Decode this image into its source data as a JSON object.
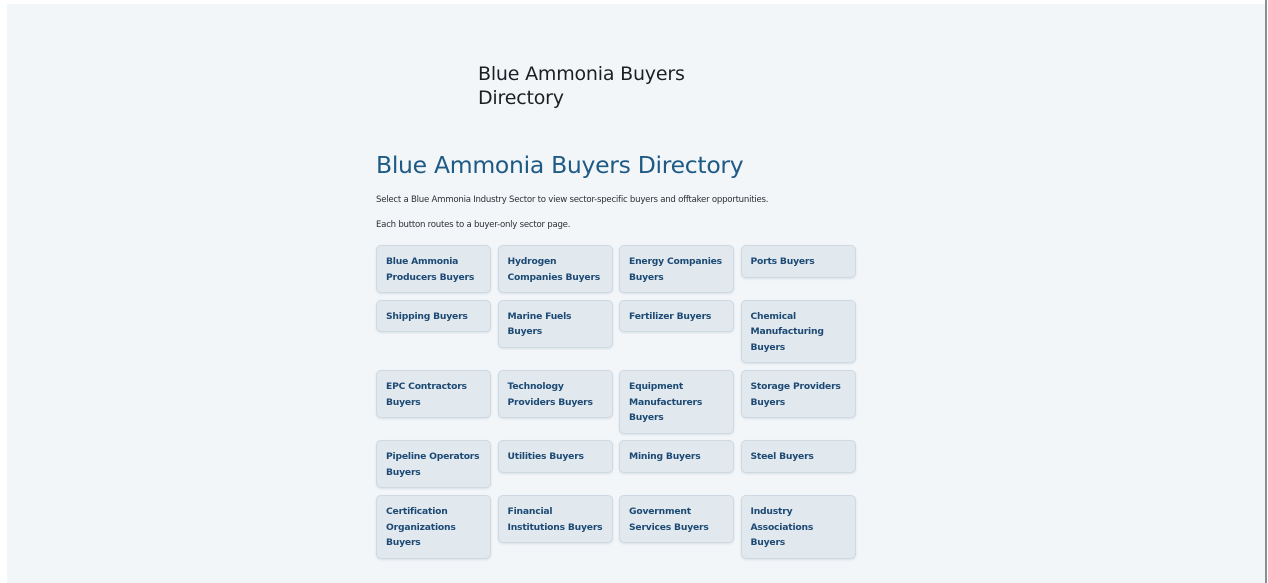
{
  "site": {
    "title": "Blue Ammonia Buyers Directory"
  },
  "main": {
    "heading": "Blue Ammonia Buyers Directory",
    "description": "Select a Blue Ammonia Industry Sector to view sector-specific buyers and offtaker opportunities.",
    "note": "Each button routes to a buyer-only sector page."
  },
  "sectors": [
    "Blue Ammonia Producers Buyers",
    "Hydrogen Companies Buyers",
    "Energy Companies Buyers",
    "Ports Buyers",
    "Shipping Buyers",
    "Marine Fuels Buyers",
    "Fertilizer Buyers",
    "Chemical Manufacturing Buyers",
    "EPC Contractors Buyers",
    "Technology Providers Buyers",
    "Equipment Manufacturers Buyers",
    "Storage Providers Buyers",
    "Pipeline Operators Buyers",
    "Utilities Buyers",
    "Mining Buyers",
    "Steel Buyers",
    "Certification Organizations Buyers",
    "Financial Institutions Buyers",
    "Government Services Buyers",
    "Industry Associations Buyers"
  ]
}
